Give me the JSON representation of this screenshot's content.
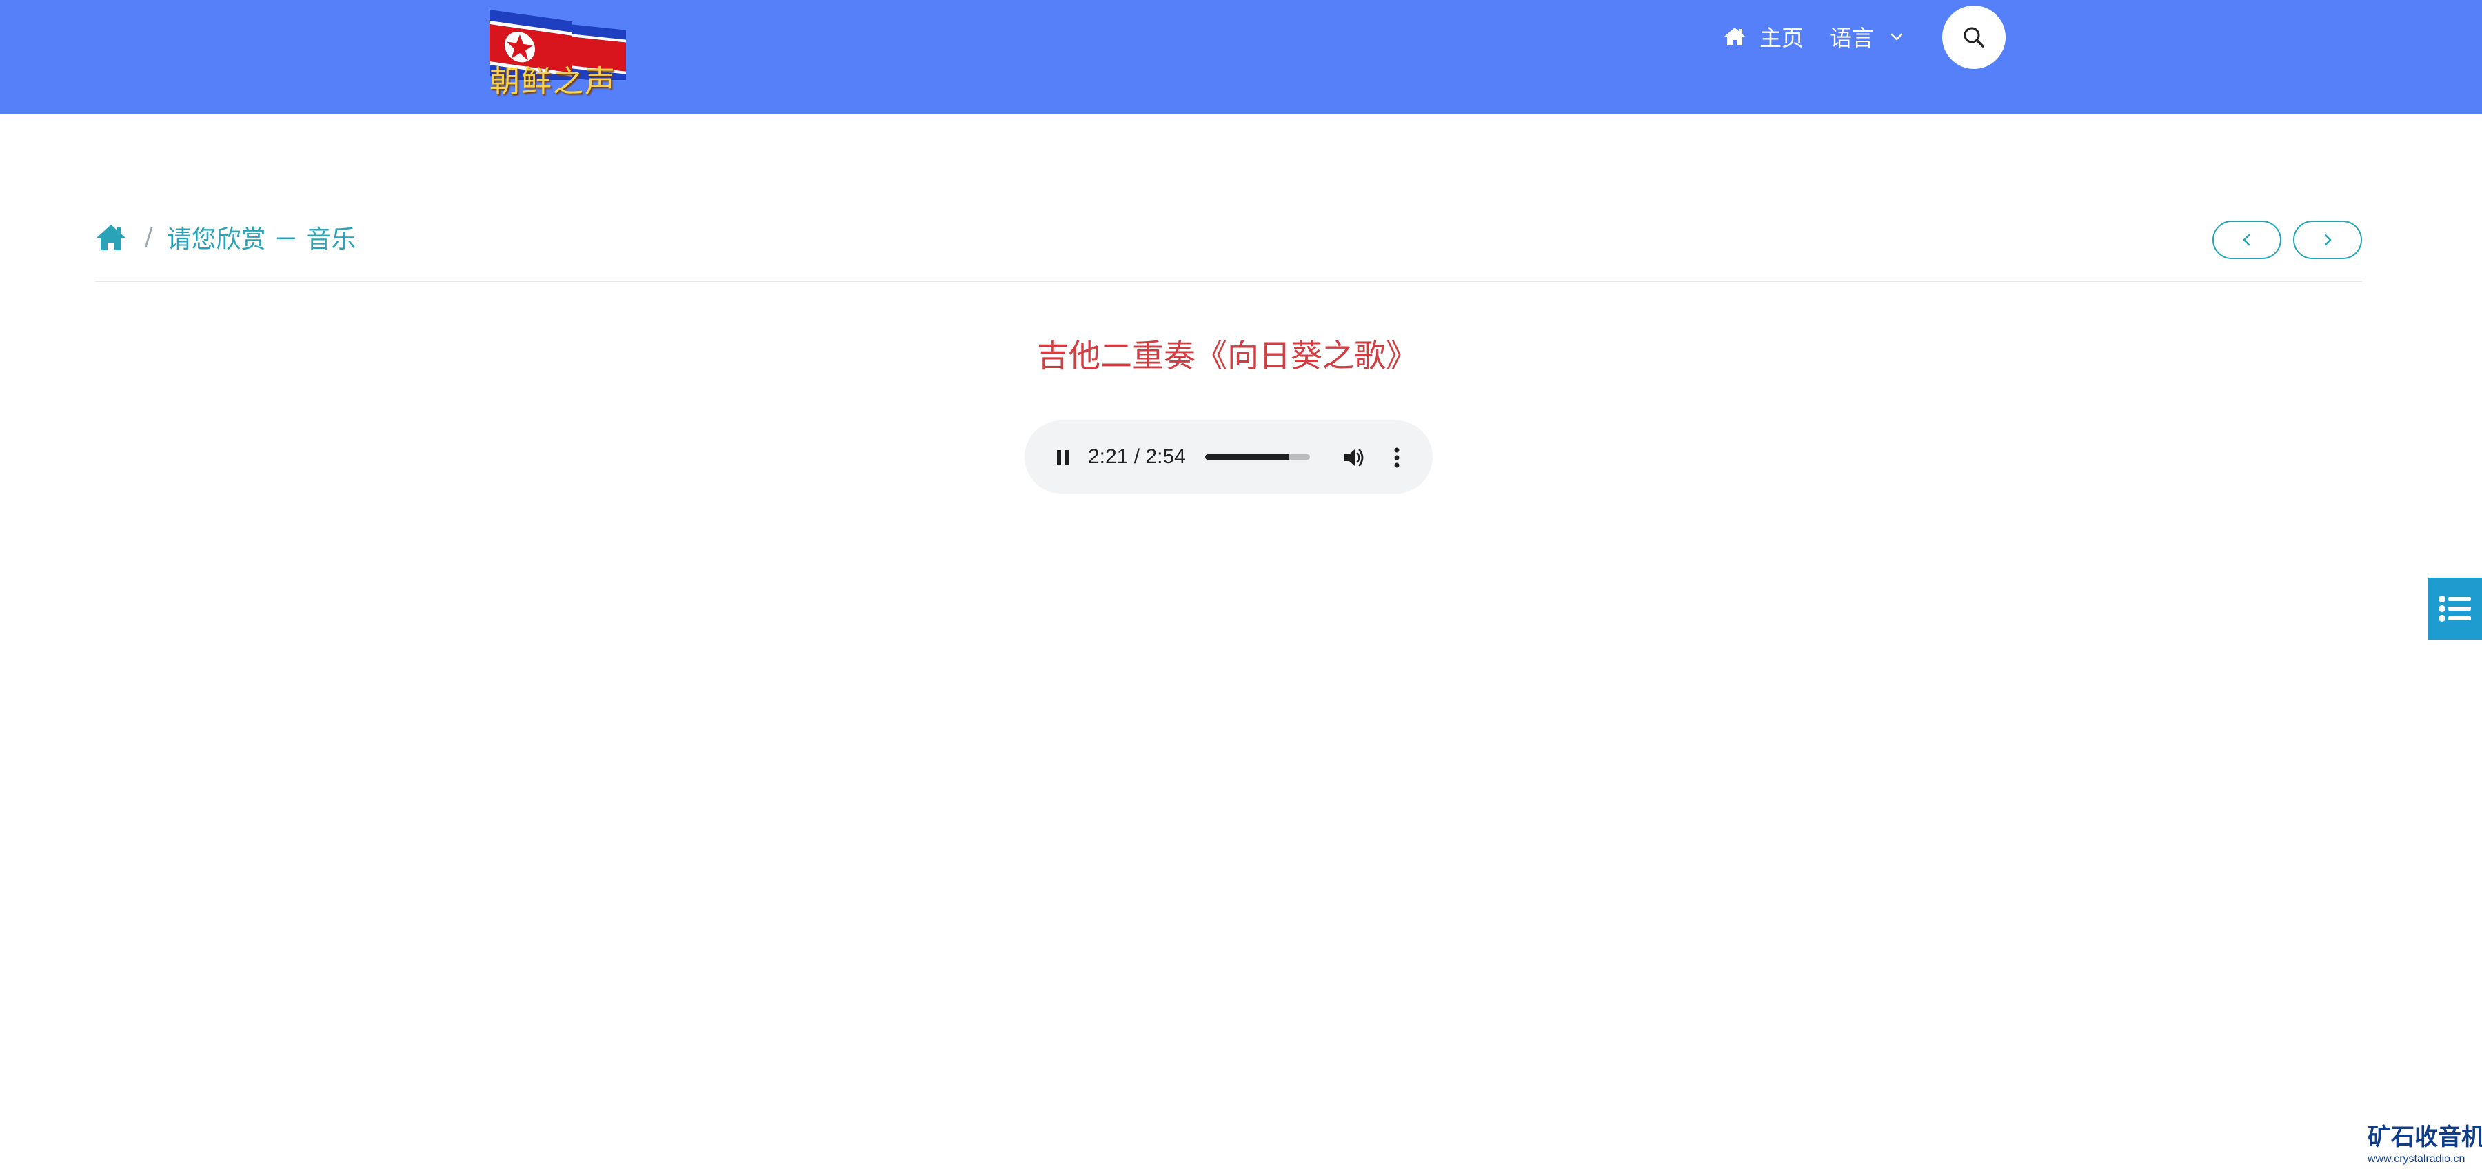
{
  "header": {
    "logo_text": "朝鲜之声",
    "nav": {
      "home_label": "主页",
      "language_label": "语言"
    },
    "bg_color": "#5580fa"
  },
  "breadcrumb": {
    "section": "请您欣赏 － 音乐"
  },
  "content": {
    "title": "吉他二重奏《向日葵之歌》"
  },
  "audio_player": {
    "time_display": "2:21 / 2:54",
    "current_time": "2:21",
    "duration": "2:54",
    "state": "playing",
    "volume": 0.8
  },
  "watermark": {
    "text": "矿石收音机",
    "url": "www.crystalradio.cn"
  },
  "icons": {
    "home": "home-icon",
    "language_dropdown": "chevron-down-icon",
    "search": "search-icon",
    "prev": "chevron-left-icon",
    "next": "chevron-right-icon",
    "pause": "pause-icon",
    "volume": "volume-icon",
    "more": "more-vertical-icon",
    "side_menu": "list-icon"
  },
  "colors": {
    "accent": "#2aa3b8",
    "title": "#d13d40",
    "side_tab": "#1e9bcf"
  }
}
